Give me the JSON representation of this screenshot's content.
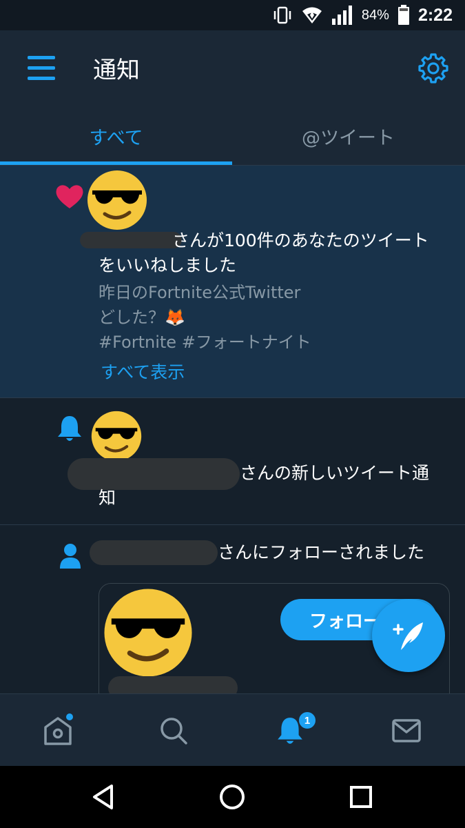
{
  "status_bar": {
    "battery_percent": "84%",
    "time": "2:22",
    "icons": [
      "vibrate-icon",
      "wifi-icon",
      "signal-icon",
      "battery-icon"
    ]
  },
  "header": {
    "title": "通知",
    "icons": [
      "menu-icon",
      "settings-gear-icon"
    ]
  },
  "tabs": [
    {
      "label": "すべて",
      "active": true
    },
    {
      "label": "@ツイート",
      "active": false
    }
  ],
  "notifications": [
    {
      "type": "like",
      "icon": "heart-icon",
      "text_line1": "さんが100件のあなたのツイート",
      "text_line2": "をいいねしました",
      "tweet_lines": [
        "昨日のFortnite公式Twitter",
        "どした？🦊",
        "#Fortnite #フォートナイト"
      ],
      "show_all": "すべて表示"
    },
    {
      "type": "tweet_notification",
      "icon": "bell-icon",
      "text_line1": "さんの新しいツイート通",
      "text_line2": "知"
    },
    {
      "type": "follow",
      "icon": "person-icon",
      "text_line1": "さんにフォローされました",
      "follow_button": "フォロー"
    }
  ],
  "fab": {
    "icon": "compose-tweet-icon"
  },
  "bottom_nav": {
    "items": [
      "home-icon",
      "search-icon",
      "notifications-bell-icon",
      "messages-icon"
    ],
    "notification_badge": "1"
  },
  "colors": {
    "accent": "#1da1f2",
    "background": "#15202b",
    "highlight": "#18324a",
    "like": "#e0245e",
    "secondary_text": "#8899a6"
  }
}
